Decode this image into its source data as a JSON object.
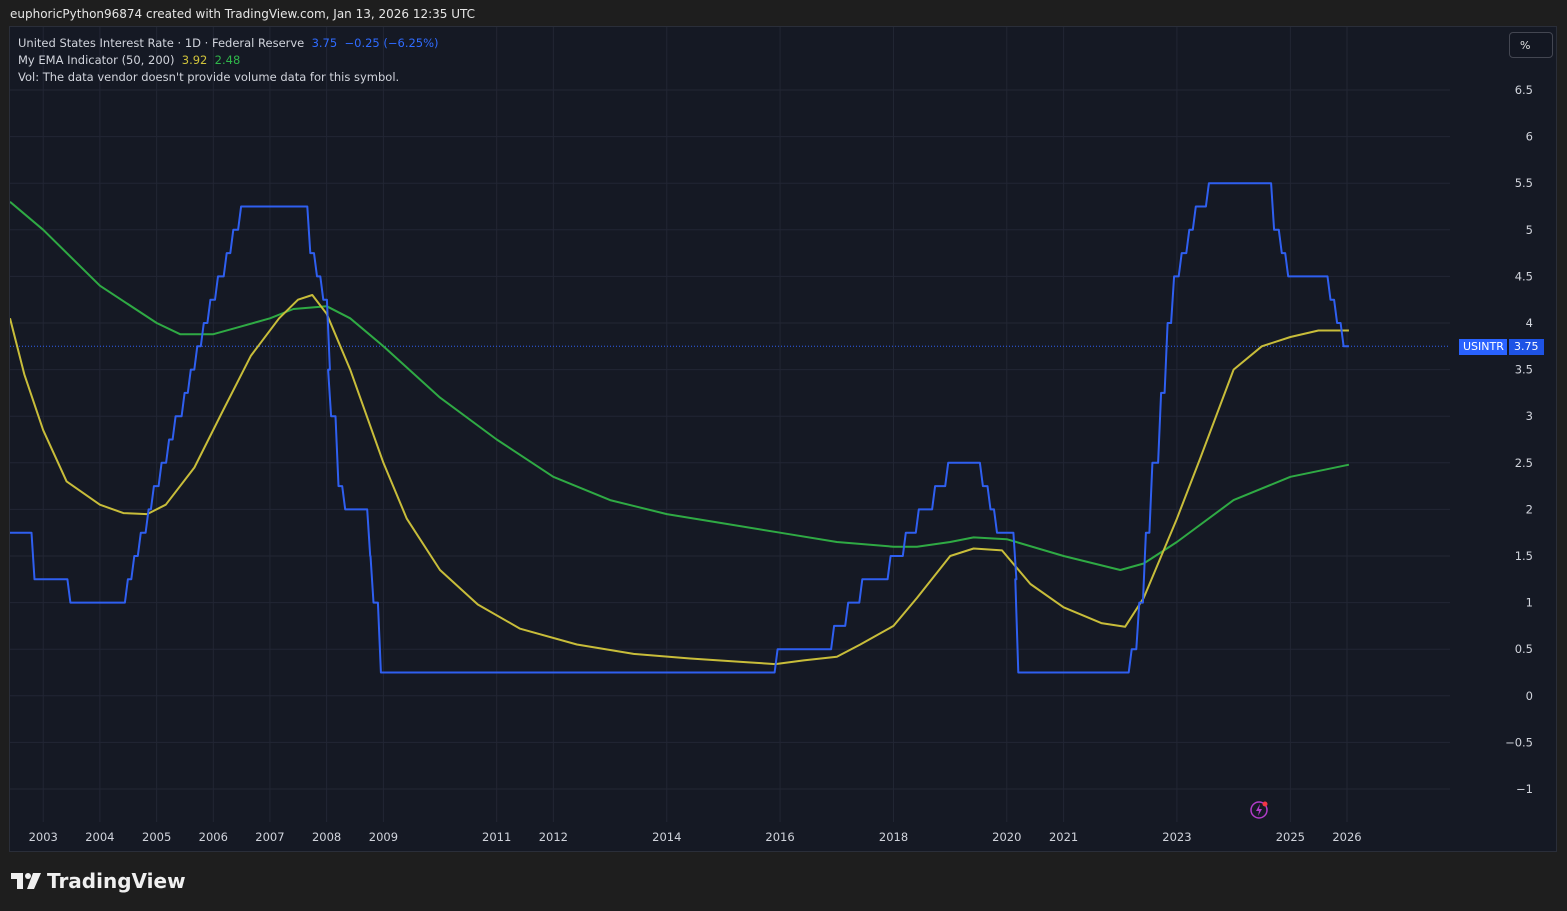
{
  "header": {
    "attribution": "euphoricPython96874 created with TradingView.com, Jan 13, 2026 12:35 UTC"
  },
  "legend": {
    "symbol_line": "United States Interest Rate · 1D · Federal Reserve",
    "last_value": "3.75",
    "change": "−0.25 (−6.25%)",
    "indicator_name": "My EMA Indicator (50, 200)",
    "ema_fast_value": "3.92",
    "ema_slow_value": "2.48",
    "vol_line": "Vol: The data vendor doesn't provide volume data for this symbol."
  },
  "toolbar": {
    "percent_label": "%"
  },
  "price_tag": {
    "symbol": "USINTR",
    "value": "3.75"
  },
  "footer": {
    "brand": "TradingView"
  },
  "colors": {
    "background": "#151924",
    "rate": "#2f5ff0",
    "ema_fast": "#c8bd3a",
    "ema_slow": "#2faa44",
    "grid": "#222634"
  },
  "chart_data": {
    "type": "line",
    "title": "United States Interest Rate",
    "xlabel": "",
    "ylabel": "",
    "ylim": [
      -1.3,
      6.9
    ],
    "y_ticks": [
      "6.5",
      "6",
      "5.5",
      "5",
      "4.5",
      "4",
      "3.5",
      "3",
      "2.5",
      "2",
      "1.5",
      "1",
      "0.5",
      "0",
      "−0.5",
      "−1"
    ],
    "y_tick_values": [
      6.5,
      6,
      5.5,
      5,
      4.5,
      4,
      3.5,
      3,
      2.5,
      2,
      1.5,
      1,
      0.5,
      0,
      -0.5,
      -1
    ],
    "x_ticks": [
      "2003",
      "2004",
      "2005",
      "2006",
      "2007",
      "2008",
      "2009",
      "2011",
      "2012",
      "2014",
      "2016",
      "2018",
      "2020",
      "2021",
      "2023",
      "2025",
      "2026"
    ],
    "x_tick_dates": [
      "2003-01-01",
      "2004-01-01",
      "2005-01-01",
      "2006-01-01",
      "2007-01-01",
      "2008-01-01",
      "2009-01-01",
      "2011-01-01",
      "2012-01-01",
      "2014-01-01",
      "2016-01-01",
      "2018-01-01",
      "2020-01-01",
      "2021-01-01",
      "2023-01-01",
      "2025-01-01",
      "2026-01-01"
    ],
    "grid": true,
    "current_value_line": 3.75,
    "series": [
      {
        "name": "United States Interest Rate",
        "step": true,
        "points": [
          [
            "2002-06-01",
            1.75
          ],
          [
            "2002-11-06",
            1.25
          ],
          [
            "2003-06-25",
            1.0
          ],
          [
            "2004-06-30",
            1.25
          ],
          [
            "2004-08-10",
            1.5
          ],
          [
            "2004-09-21",
            1.75
          ],
          [
            "2004-11-10",
            2.0
          ],
          [
            "2004-12-14",
            2.25
          ],
          [
            "2005-02-02",
            2.5
          ],
          [
            "2005-03-22",
            2.75
          ],
          [
            "2005-05-03",
            3.0
          ],
          [
            "2005-06-30",
            3.25
          ],
          [
            "2005-08-09",
            3.5
          ],
          [
            "2005-09-20",
            3.75
          ],
          [
            "2005-11-01",
            4.0
          ],
          [
            "2005-12-13",
            4.25
          ],
          [
            "2006-01-31",
            4.5
          ],
          [
            "2006-03-28",
            4.75
          ],
          [
            "2006-05-10",
            5.0
          ],
          [
            "2006-06-29",
            5.25
          ],
          [
            "2007-09-18",
            4.75
          ],
          [
            "2007-10-31",
            4.5
          ],
          [
            "2007-12-11",
            4.25
          ],
          [
            "2008-01-22",
            3.5
          ],
          [
            "2008-01-30",
            3.0
          ],
          [
            "2008-03-18",
            2.25
          ],
          [
            "2008-04-30",
            2.0
          ],
          [
            "2008-10-08",
            1.5
          ],
          [
            "2008-10-29",
            1.0
          ],
          [
            "2008-12-16",
            0.25
          ],
          [
            "2015-12-16",
            0.5
          ],
          [
            "2016-12-14",
            0.75
          ],
          [
            "2017-03-15",
            1.0
          ],
          [
            "2017-06-14",
            1.25
          ],
          [
            "2017-12-13",
            1.5
          ],
          [
            "2018-03-21",
            1.75
          ],
          [
            "2018-06-13",
            2.0
          ],
          [
            "2018-09-26",
            2.25
          ],
          [
            "2018-12-19",
            2.5
          ],
          [
            "2019-07-31",
            2.25
          ],
          [
            "2019-09-18",
            2.0
          ],
          [
            "2019-10-30",
            1.75
          ],
          [
            "2020-03-03",
            1.25
          ],
          [
            "2020-03-15",
            0.25
          ],
          [
            "2022-03-16",
            0.5
          ],
          [
            "2022-05-04",
            1.0
          ],
          [
            "2022-06-15",
            1.75
          ],
          [
            "2022-07-27",
            2.5
          ],
          [
            "2022-09-21",
            3.25
          ],
          [
            "2022-11-02",
            4.0
          ],
          [
            "2022-12-14",
            4.5
          ],
          [
            "2023-02-01",
            4.75
          ],
          [
            "2023-03-22",
            5.0
          ],
          [
            "2023-05-03",
            5.25
          ],
          [
            "2023-07-26",
            5.5
          ],
          [
            "2024-09-18",
            5.0
          ],
          [
            "2024-11-07",
            4.75
          ],
          [
            "2024-12-18",
            4.5
          ],
          [
            "2025-09-17",
            4.25
          ],
          [
            "2025-10-29",
            4.0
          ],
          [
            "2025-12-10",
            3.75
          ],
          [
            "2026-01-13",
            3.75
          ]
        ]
      },
      {
        "name": "EMA 50",
        "points": [
          [
            "2002-06-01",
            4.05
          ],
          [
            "2002-09-01",
            3.45
          ],
          [
            "2003-01-01",
            2.85
          ],
          [
            "2003-06-01",
            2.3
          ],
          [
            "2004-01-01",
            2.05
          ],
          [
            "2004-06-01",
            1.96
          ],
          [
            "2004-11-01",
            1.95
          ],
          [
            "2005-03-01",
            2.05
          ],
          [
            "2005-09-01",
            2.45
          ],
          [
            "2006-03-01",
            3.05
          ],
          [
            "2006-09-01",
            3.65
          ],
          [
            "2007-03-01",
            4.05
          ],
          [
            "2007-07-01",
            4.25
          ],
          [
            "2007-10-01",
            4.3
          ],
          [
            "2008-01-01",
            4.1
          ],
          [
            "2008-06-01",
            3.5
          ],
          [
            "2009-01-01",
            2.5
          ],
          [
            "2009-06-01",
            1.9
          ],
          [
            "2010-01-01",
            1.35
          ],
          [
            "2010-09-01",
            0.98
          ],
          [
            "2011-06-01",
            0.72
          ],
          [
            "2012-06-01",
            0.55
          ],
          [
            "2013-06-01",
            0.45
          ],
          [
            "2014-06-01",
            0.4
          ],
          [
            "2015-06-01",
            0.36
          ],
          [
            "2015-12-01",
            0.34
          ],
          [
            "2016-06-01",
            0.38
          ],
          [
            "2017-01-01",
            0.42
          ],
          [
            "2017-06-01",
            0.55
          ],
          [
            "2018-01-01",
            0.75
          ],
          [
            "2018-06-01",
            1.05
          ],
          [
            "2019-01-01",
            1.5
          ],
          [
            "2019-06-01",
            1.58
          ],
          [
            "2019-12-01",
            1.56
          ],
          [
            "2020-06-01",
            1.2
          ],
          [
            "2021-01-01",
            0.95
          ],
          [
            "2021-09-01",
            0.78
          ],
          [
            "2022-02-01",
            0.74
          ],
          [
            "2022-06-01",
            1.05
          ],
          [
            "2023-01-01",
            1.9
          ],
          [
            "2023-06-01",
            2.55
          ],
          [
            "2024-01-01",
            3.5
          ],
          [
            "2024-07-01",
            3.75
          ],
          [
            "2025-01-01",
            3.85
          ],
          [
            "2025-07-01",
            3.92
          ],
          [
            "2026-01-13",
            3.92
          ]
        ]
      },
      {
        "name": "EMA 200",
        "points": [
          [
            "2002-06-01",
            5.3
          ],
          [
            "2003-01-01",
            5.0
          ],
          [
            "2004-01-01",
            4.4
          ],
          [
            "2005-01-01",
            4.0
          ],
          [
            "2005-06-01",
            3.88
          ],
          [
            "2006-01-01",
            3.88
          ],
          [
            "2006-06-01",
            3.95
          ],
          [
            "2007-01-01",
            4.05
          ],
          [
            "2007-06-01",
            4.15
          ],
          [
            "2008-01-01",
            4.18
          ],
          [
            "2008-06-01",
            4.05
          ],
          [
            "2009-01-01",
            3.75
          ],
          [
            "2010-01-01",
            3.2
          ],
          [
            "2011-01-01",
            2.75
          ],
          [
            "2012-01-01",
            2.35
          ],
          [
            "2013-01-01",
            2.1
          ],
          [
            "2014-01-01",
            1.95
          ],
          [
            "2015-01-01",
            1.85
          ],
          [
            "2016-01-01",
            1.75
          ],
          [
            "2017-01-01",
            1.65
          ],
          [
            "2018-01-01",
            1.6
          ],
          [
            "2018-06-01",
            1.6
          ],
          [
            "2019-01-01",
            1.65
          ],
          [
            "2019-06-01",
            1.7
          ],
          [
            "2020-01-01",
            1.68
          ],
          [
            "2021-01-01",
            1.5
          ],
          [
            "2022-01-01",
            1.35
          ],
          [
            "2022-06-01",
            1.42
          ],
          [
            "2023-01-01",
            1.65
          ],
          [
            "2024-01-01",
            2.1
          ],
          [
            "2025-01-01",
            2.35
          ],
          [
            "2026-01-13",
            2.48
          ]
        ]
      }
    ]
  }
}
